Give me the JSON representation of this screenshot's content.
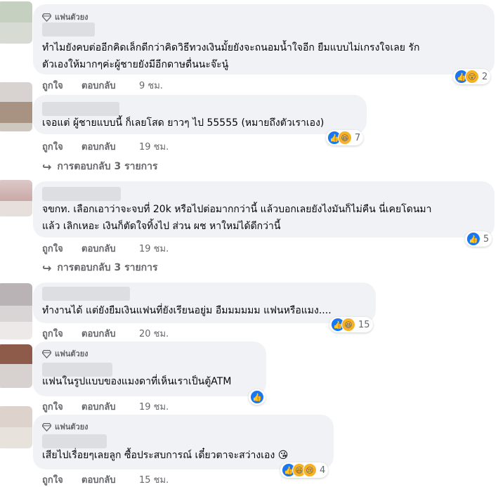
{
  "badge_label": "แฟนตัวยง",
  "actions": {
    "like": "ถูกใจ",
    "reply": "ตอบกลับ"
  },
  "comments": [
    {
      "text1": "ทำไมยังคบต่ออีกคิดเล็กดีกว่าคิดวิธีทวงเงินมั้ยยังจะถนอมน้ำใจอีก ยืมแบบไม่เกรงใจเลย รัก",
      "text2": "ตัวเองให้มากๆค่ะผู้ชายยังมีอีกดาษดื่นนะจ๊ะนู๋",
      "time": "9 ชม.",
      "reaction_count": "2",
      "replies": ""
    },
    {
      "text1": "เจอแต่ ผู้ชายแบบนี้ ก็เลยโสด ยาวๆ ไป 55555 (หมายถึงตัวเราเอง)",
      "text2": "",
      "time": "19 ชม.",
      "reaction_count": "7",
      "replies": "การตอบกลับ 3 รายการ"
    },
    {
      "text1": "จขกท. เลือกเอาว่าจะจบที่ 20k หรือไปต่อมากกว่านี้ แล้วบอกเลยยังไงมันก็ไม่คืน นี่เคยโดนมา",
      "text2": "แล้ว เลิกเหอะ เงินก็ตัดใจทิ้งไป ส่วน ผช หาใหม่ได้ดีกว่านี้",
      "time": "19 ชม.",
      "reaction_count": "5",
      "replies": "การตอบกลับ 3 รายการ"
    },
    {
      "text1": "ทำงานได้ แต่ยังยืมเงินแฟนที่ยังเรียนอยู่ม อืมมมมมม แฟนหรือแมง....",
      "text2": "",
      "time": "20 ชม.",
      "reaction_count": "15",
      "replies": ""
    },
    {
      "text1": "แฟนในรูปแบบของแมงดาที่เห็นเราเป็นตู้ATM",
      "text2": "",
      "time": "19 ชม.",
      "reaction_count": "",
      "replies": ""
    },
    {
      "text1": "เสียไปเรื่อยๆเลยลูก ซื้อประสบการณ์ เดี๋ยวตาจะสว่างเอง 😘",
      "text2": "",
      "time": "15 ชม.",
      "reaction_count": "4",
      "replies": ""
    }
  ],
  "colors": {
    "bubble": "#f0f2f5",
    "like_blue": "#1877f2",
    "muted": "#65676b"
  }
}
